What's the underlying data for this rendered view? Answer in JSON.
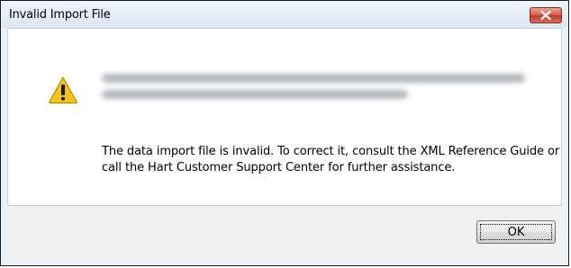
{
  "window": {
    "title": "Invalid Import File"
  },
  "titlebar_controls": {
    "close_icon": "close-icon"
  },
  "content": {
    "icon": "warning-icon",
    "message": "The data import file is invalid.  To correct it, consult the XML Reference Guide or call the Hart Customer Support Center for further assistance."
  },
  "buttons": {
    "ok_label": "OK"
  },
  "colors": {
    "close_button": "#c84a37",
    "warning_yellow": "#f5c518"
  }
}
